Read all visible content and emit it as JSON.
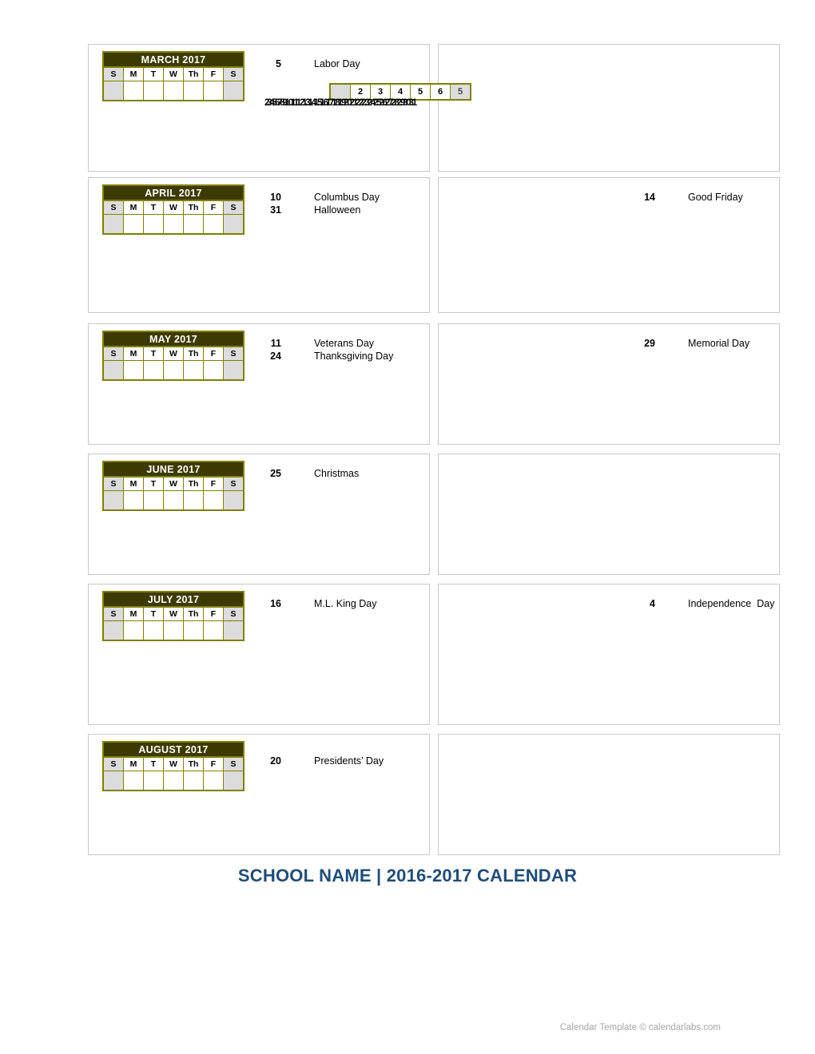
{
  "document": {
    "title": "SCHOOL NAME | 2016-2017 CALENDAR",
    "footer": "Calendar Template © calendarlabs.com"
  },
  "theme": {
    "header_bg": "#3D3A00",
    "header_text": "#FFFFFF",
    "grid_border": "#808000",
    "weekend_bg": "#DCDCDC",
    "panel_border": "#C8C8C8",
    "title_color": "#1F4E79",
    "footer_color": "#A6A6A6"
  },
  "weekday_headers": [
    "S",
    "M",
    "T",
    "W",
    "Th",
    "F",
    "S"
  ],
  "months": [
    {
      "name": "MARCH 2017",
      "left_holidays": [
        {
          "date": "5",
          "name": "Labor Day"
        }
      ],
      "right_holidays": []
    },
    {
      "name": "APRIL 2017",
      "left_holidays": [
        {
          "date": "10",
          "name": "Columbus Day"
        },
        {
          "date": "31",
          "name": "Halloween"
        }
      ],
      "right_holidays": [
        {
          "date": "14",
          "name": "Good Friday"
        }
      ]
    },
    {
      "name": "MAY 2017",
      "left_holidays": [
        {
          "date": "11",
          "name": "Veterans Day"
        },
        {
          "date": "24",
          "name": "Thanksgiving Day"
        }
      ],
      "right_holidays": [
        {
          "date": "29",
          "name": "Memorial Day"
        }
      ]
    },
    {
      "name": "JUNE 2017",
      "left_holidays": [
        {
          "date": "25",
          "name": "Christmas"
        }
      ],
      "right_holidays": []
    },
    {
      "name": "JULY 2017",
      "left_holidays": [
        {
          "date": "16",
          "name": "M.L. King Day"
        }
      ],
      "right_holidays": [
        {
          "date": "4",
          "name": "Independence  Day"
        }
      ]
    },
    {
      "name": "AUGUST 2017",
      "left_holidays": [
        {
          "date": "20",
          "name": "Presidents’ Day"
        }
      ],
      "right_holidays": []
    }
  ],
  "overflow_artifact": {
    "description": "collapsed-overlapping-day-row",
    "row_cells": [
      "",
      "2",
      "3",
      "4",
      "5",
      "6",
      "5"
    ],
    "overlapped_numbers": [
      "2",
      "3",
      "4",
      "5",
      "6",
      "7",
      "8",
      "9",
      "10",
      "11",
      "12",
      "13",
      "14",
      "15",
      "16",
      "17",
      "18",
      "19",
      "20",
      "21",
      "22",
      "23",
      "24",
      "25",
      "26",
      "27",
      "28",
      "29",
      "30",
      "31"
    ]
  }
}
